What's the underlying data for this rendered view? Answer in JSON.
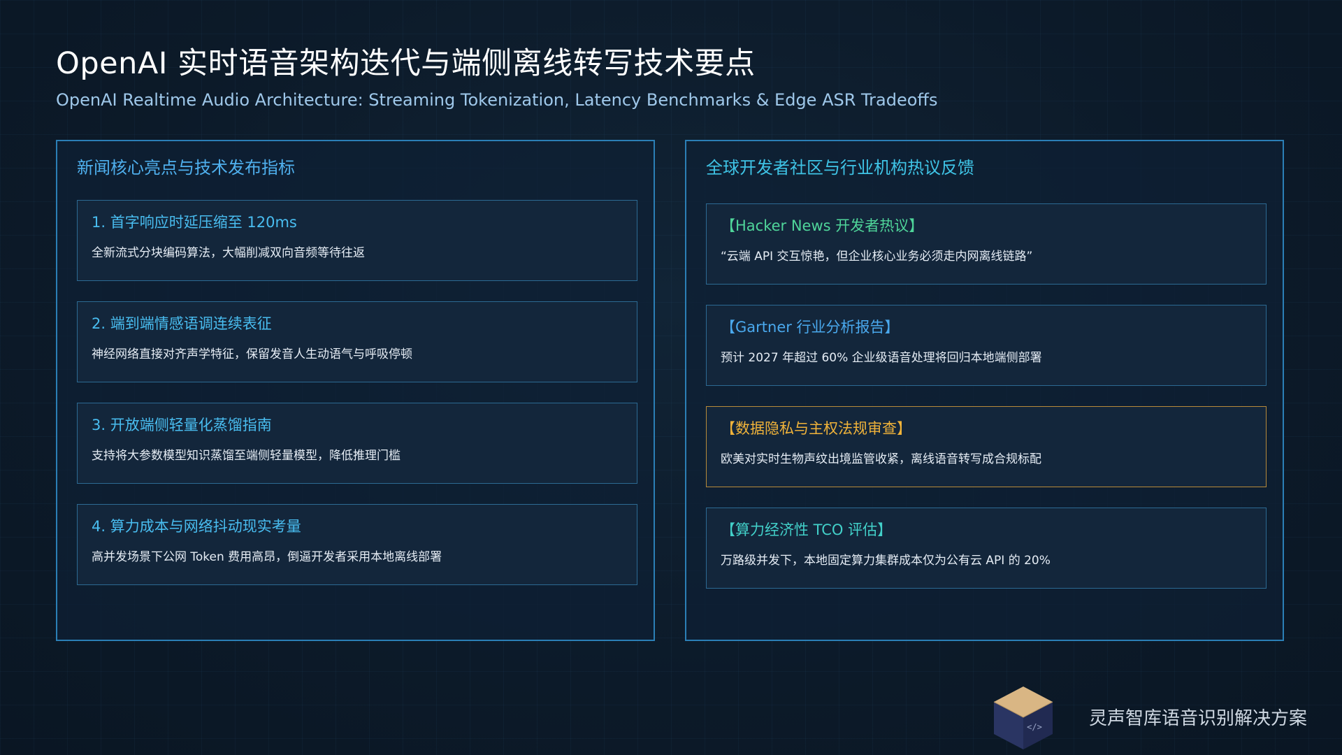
{
  "header": {
    "title": "OpenAI 实时语音架构迭代与端侧离线转写技术要点",
    "subtitle": "OpenAI Realtime Audio Architecture: Streaming Tokenization, Latency Benchmarks & Edge ASR Tradeoffs"
  },
  "left_panel": {
    "heading": "新闻核心亮点与技术发布指标",
    "items": [
      {
        "title": "1. 首字响应时延压缩至 120ms",
        "desc": "全新流式分块编码算法，大幅削减双向音频等待往返"
      },
      {
        "title": "2. 端到端情感语调连续表征",
        "desc": "神经网络直接对齐声学特征，保留发音人生动语气与呼吸停顿"
      },
      {
        "title": "3. 开放端侧轻量化蒸馏指南",
        "desc": "支持将大参数模型知识蒸馏至端侧轻量模型，降低推理门槛"
      },
      {
        "title": "4. 算力成本与网络抖动现实考量",
        "desc": "高并发场景下公网 Token 费用高昂，倒逼开发者采用本地离线部署"
      }
    ]
  },
  "right_panel": {
    "heading": "全球开发者社区与行业机构热议反馈",
    "items": [
      {
        "title": "【Hacker News 开发者热议】",
        "desc": "“云端 API 交互惊艳，但企业核心业务必须走内网离线链路”"
      },
      {
        "title": "【Gartner 行业分析报告】",
        "desc": "预计 2027 年超过 60% 企业级语音处理将回归本地端侧部署"
      },
      {
        "title": "【数据隐私与主权法规审查】",
        "desc": "欧美对实时生物声纹出境监管收紧，离线语音转写成合规标配"
      },
      {
        "title": "【算力经济性 TCO 评估】",
        "desc": "万路级并发下，本地固定算力集群成本仅为公有云 API 的 20%"
      }
    ]
  },
  "brand": {
    "name": "灵声智库语音识别解决方案",
    "logo_glyph": "</>",
    "logo_icon": "cube-code-icon"
  },
  "colors": {
    "background": "#0d1b2a",
    "panel_border": "#2b7fb6",
    "card_border": "#2c6a93",
    "hn_accent": "#4fd59a",
    "gartner_accent": "#4aa9ee",
    "privacy_accent": "#f0b33a",
    "tco_accent": "#42d0c9"
  }
}
